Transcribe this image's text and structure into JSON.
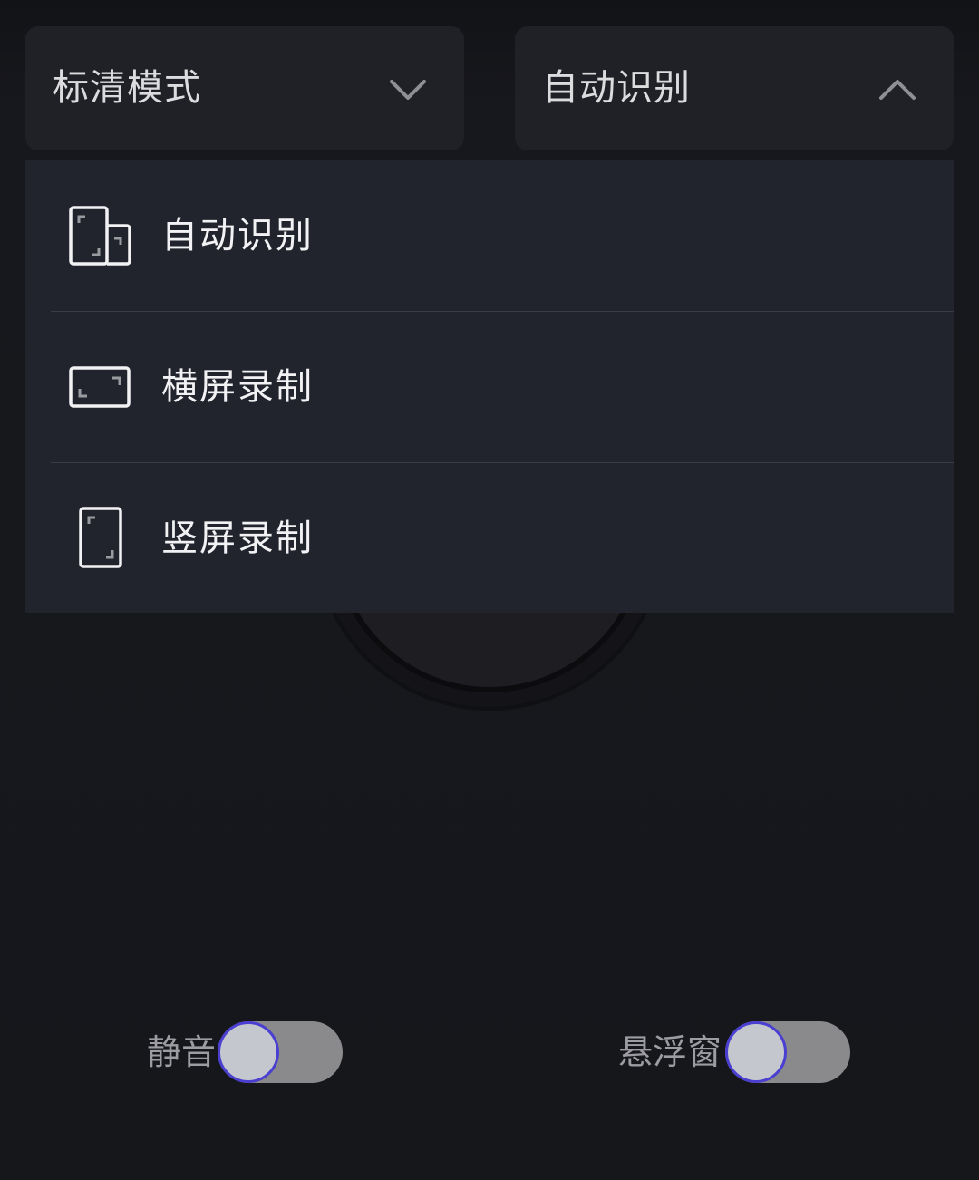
{
  "quality_select": {
    "value": "标清模式",
    "expanded": false,
    "icon": "chevron-down-icon"
  },
  "orientation_select": {
    "value": "自动识别",
    "expanded": true,
    "icon": "chevron-up-icon"
  },
  "orientation_menu": {
    "options": [
      {
        "label": "自动识别",
        "icon": "auto-rotate-icon"
      },
      {
        "label": "横屏录制",
        "icon": "landscape-icon"
      },
      {
        "label": "竖屏录制",
        "icon": "portrait-icon"
      }
    ]
  },
  "toggles": {
    "mute": {
      "label": "静音",
      "on": false
    },
    "floating_window": {
      "label": "悬浮窗",
      "on": false
    }
  },
  "colors": {
    "background": "#16171b",
    "dropdown": "#21242c",
    "select_box": "#1f2126",
    "switch_track": "#8a8a8c",
    "switch_knob": "#c4c7cd",
    "switch_knob_border": "#4a3fd0"
  }
}
